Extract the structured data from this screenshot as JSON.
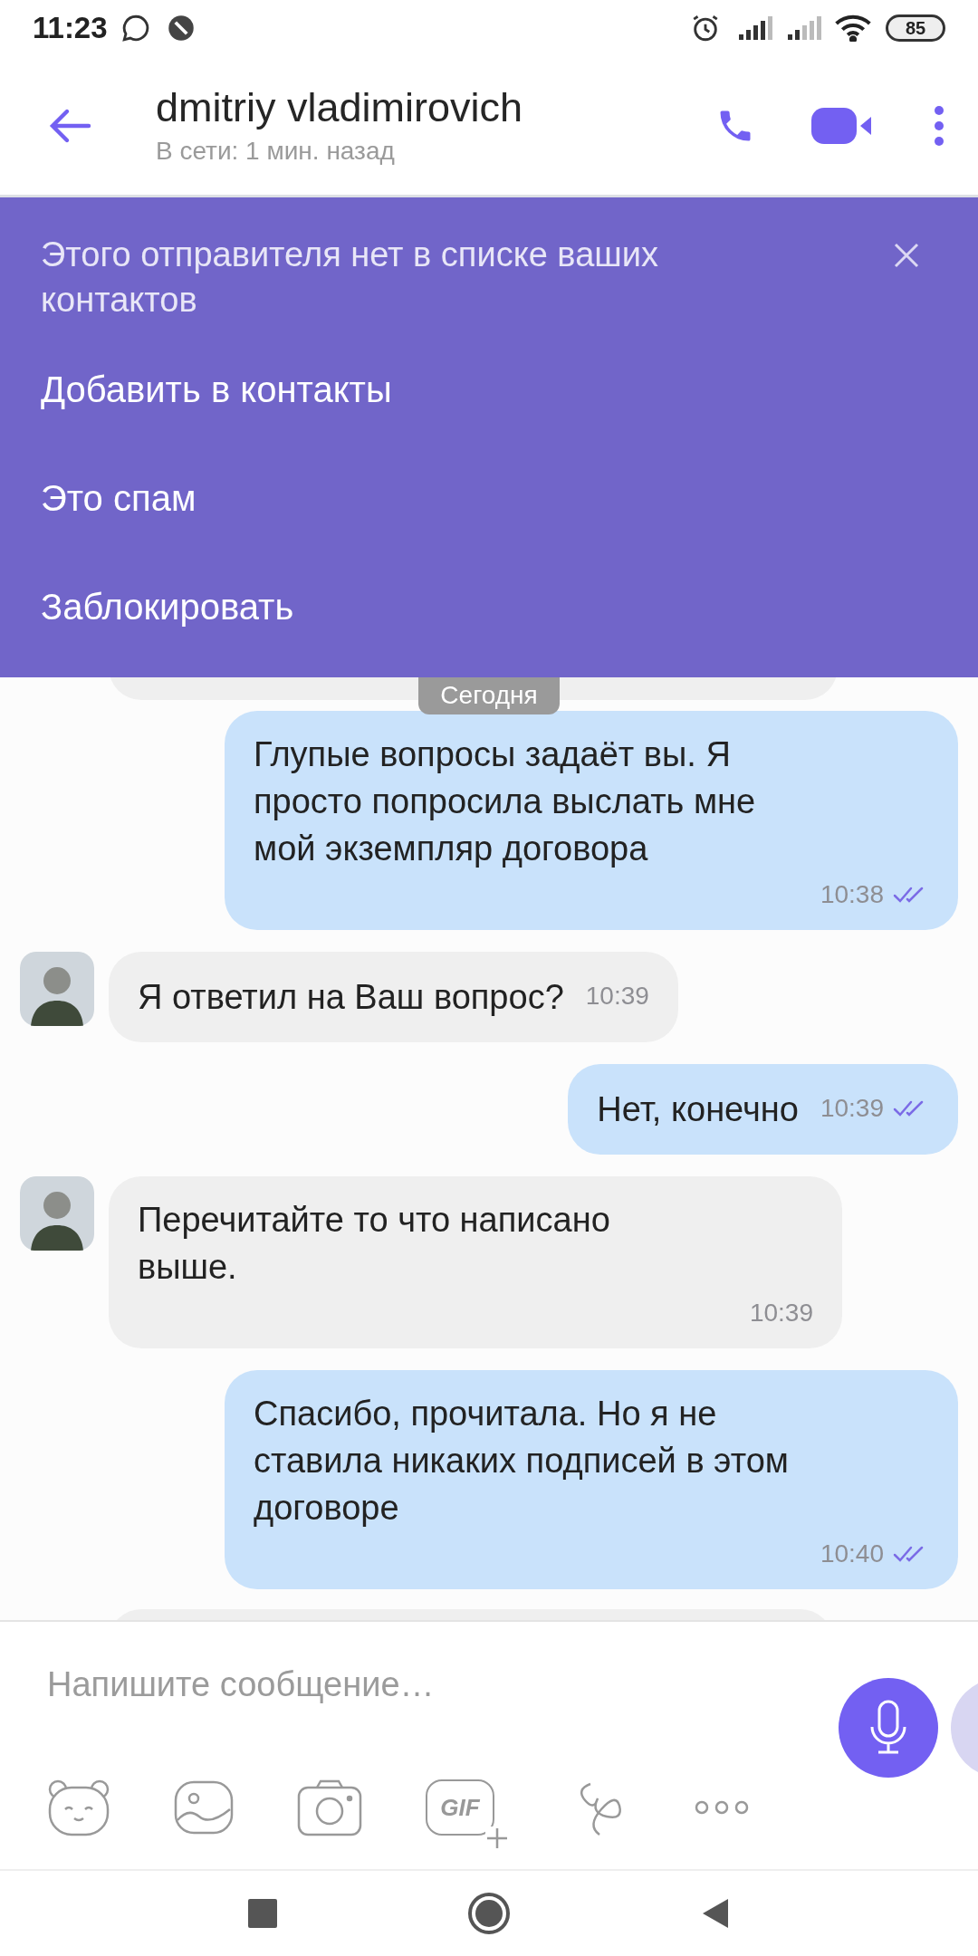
{
  "status_bar": {
    "time": "11:23",
    "battery": "85"
  },
  "header": {
    "title": "dmitriy vladimirovich",
    "subtitle": "В сети: 1 мин. назад"
  },
  "banner": {
    "message": "Этого отправителя нет в списке ваших контактов",
    "actions": [
      "Добавить в контакты",
      "Это спам",
      "Заблокировать"
    ]
  },
  "date_chip": "Сегодня",
  "messages": [
    {
      "kind": "outgoing",
      "text": "Глупые вопросы задаёт вы. Я просто попросила выслать мне мой экземпляр договора",
      "time": "10:38",
      "read": true,
      "inline_time": false
    },
    {
      "kind": "incoming",
      "text": "Я ответил на Ваш вопрос?",
      "time": "10:39",
      "inline_time": true
    },
    {
      "kind": "outgoing",
      "text": "Нет, конечно",
      "time": "10:39",
      "read": true,
      "inline_time": true
    },
    {
      "kind": "incoming",
      "text": "Перечитайте то что написано выше.",
      "time": "10:39",
      "inline_time": false
    },
    {
      "kind": "outgoing",
      "text": "Спасибо, прочитала. Но я не ставила никаких подписей в этом договоре",
      "time": "10:40",
      "read": true,
      "inline_time": false
    }
  ],
  "composer": {
    "placeholder": "Напишите сообщение…",
    "gif_label": "GIF"
  }
}
